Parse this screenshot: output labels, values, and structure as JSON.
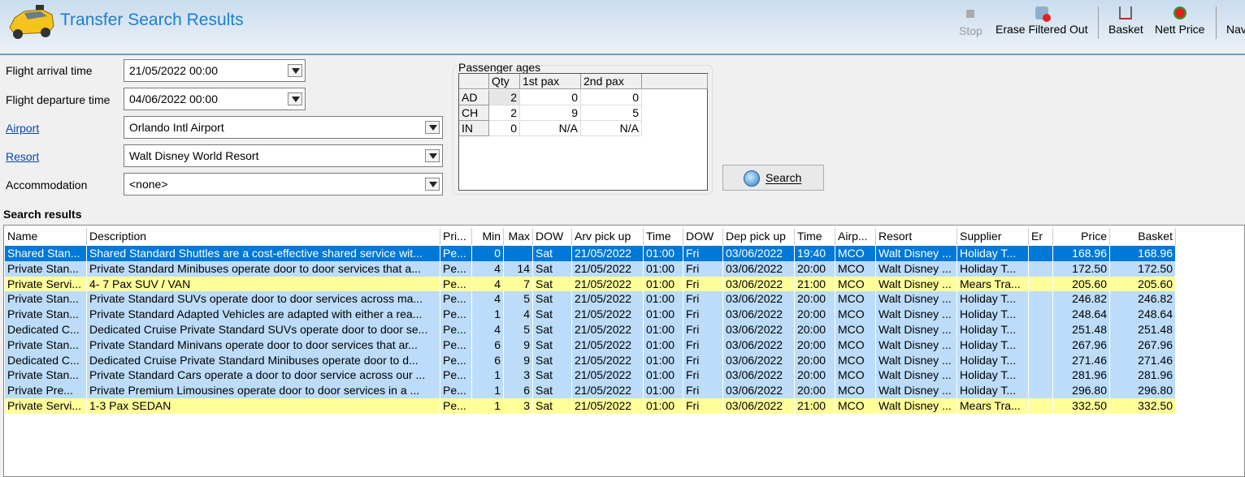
{
  "header": {
    "title": "Transfer Search Results"
  },
  "toolbar": {
    "stop": "Stop",
    "erase": "Erase Filtered Out",
    "basket": "Basket",
    "nett": "Nett Price",
    "nav": "Nav"
  },
  "form": {
    "arrival_label": "Flight arrival time",
    "arrival_value": "21/05/2022 00:00",
    "departure_label": "Flight departure time",
    "departure_value": "04/06/2022 00:00",
    "airport_label": "Airport",
    "airport_value": "Orlando Intl Airport",
    "resort_label": "Resort",
    "resort_value": "Walt Disney World Resort",
    "accom_label": "Accommodation",
    "accom_value": "<none>"
  },
  "pax": {
    "title": "Passenger ages",
    "headers": [
      "",
      "Qty",
      "1st pax",
      "2nd pax",
      ""
    ],
    "rows": [
      [
        "AD",
        "2",
        "0",
        "0"
      ],
      [
        "CH",
        "2",
        "9",
        "5"
      ],
      [
        "IN",
        "0",
        "N/A",
        "N/A"
      ]
    ]
  },
  "search_button": "Search",
  "results": {
    "label": "Search results",
    "columns": [
      "Name",
      "Description",
      "Pri...",
      "Min",
      "Max",
      "DOW",
      "Arv pick up",
      "Time",
      "DOW",
      "Dep pick up",
      "Time",
      "Airp...",
      "Resort",
      "Supplier",
      "Er",
      "Price",
      "Basket"
    ],
    "rows": [
      {
        "style": "sel",
        "cells": [
          "Shared Stan...",
          "Shared Standard Shuttles are a cost-effective shared service wit...",
          "Pe...",
          "0",
          "",
          "Sat",
          "21/05/2022",
          "01:00",
          "Fri",
          "03/06/2022",
          "19:40",
          "MCO",
          "Walt Disney ...",
          "Holiday T...",
          "",
          "168.96",
          "168.96"
        ]
      },
      {
        "style": "blue",
        "cells": [
          "Private Stan...",
          "Private Standard Minibuses operate door to door services that a...",
          "Pe...",
          "4",
          "14",
          "Sat",
          "21/05/2022",
          "01:00",
          "Fri",
          "03/06/2022",
          "20:00",
          "MCO",
          "Walt Disney ...",
          "Holiday T...",
          "",
          "172.50",
          "172.50"
        ]
      },
      {
        "style": "yel",
        "cells": [
          "Private Servi...",
          "4- 7 Pax SUV / VAN",
          "Pe...",
          "4",
          "7",
          "Sat",
          "21/05/2022",
          "01:00",
          "Fri",
          "03/06/2022",
          "21:00",
          "MCO",
          "Walt Disney ...",
          "Mears Tra...",
          "",
          "205.60",
          "205.60"
        ]
      },
      {
        "style": "blue",
        "cells": [
          "Private Stan...",
          "Private Standard SUVs operate door to door services across ma...",
          "Pe...",
          "4",
          "5",
          "Sat",
          "21/05/2022",
          "01:00",
          "Fri",
          "03/06/2022",
          "20:00",
          "MCO",
          "Walt Disney ...",
          "Holiday T...",
          "",
          "246.82",
          "246.82"
        ]
      },
      {
        "style": "blue",
        "cells": [
          "Private Stan...",
          "Private Standard Adapted Vehicles are adapted with either a rea...",
          "Pe...",
          "1",
          "4",
          "Sat",
          "21/05/2022",
          "01:00",
          "Fri",
          "03/06/2022",
          "20:00",
          "MCO",
          "Walt Disney ...",
          "Holiday T...",
          "",
          "248.64",
          "248.64"
        ]
      },
      {
        "style": "blue",
        "cells": [
          "Dedicated C...",
          "Dedicated Cruise Private Standard SUVs operate door to door se...",
          "Pe...",
          "4",
          "5",
          "Sat",
          "21/05/2022",
          "01:00",
          "Fri",
          "03/06/2022",
          "20:00",
          "MCO",
          "Walt Disney ...",
          "Holiday T...",
          "",
          "251.48",
          "251.48"
        ]
      },
      {
        "style": "blue",
        "cells": [
          "Private Stan...",
          "Private Standard Minivans operate door to door services that ar...",
          "Pe...",
          "6",
          "9",
          "Sat",
          "21/05/2022",
          "01:00",
          "Fri",
          "03/06/2022",
          "20:00",
          "MCO",
          "Walt Disney ...",
          "Holiday T...",
          "",
          "267.96",
          "267.96"
        ]
      },
      {
        "style": "blue",
        "cells": [
          "Dedicated C...",
          "Dedicated Cruise Private Standard Minibuses operate door to d...",
          "Pe...",
          "6",
          "9",
          "Sat",
          "21/05/2022",
          "01:00",
          "Fri",
          "03/06/2022",
          "20:00",
          "MCO",
          "Walt Disney ...",
          "Holiday T...",
          "",
          "271.46",
          "271.46"
        ]
      },
      {
        "style": "blue",
        "cells": [
          "Private Stan...",
          "Private Standard Cars operate a door to door service across our ...",
          "Pe...",
          "1",
          "3",
          "Sat",
          "21/05/2022",
          "01:00",
          "Fri",
          "03/06/2022",
          "20:00",
          "MCO",
          "Walt Disney ...",
          "Holiday T...",
          "",
          "281.96",
          "281.96"
        ]
      },
      {
        "style": "blue",
        "cells": [
          "Private Pre...",
          "Private Premium Limousines operate door to door services in a ...",
          "Pe...",
          "1",
          "6",
          "Sat",
          "21/05/2022",
          "01:00",
          "Fri",
          "03/06/2022",
          "20:00",
          "MCO",
          "Walt Disney ...",
          "Holiday T...",
          "",
          "296.80",
          "296.80"
        ]
      },
      {
        "style": "yel",
        "cells": [
          "Private Servi...",
          "1-3 Pax SEDAN",
          "Pe...",
          "1",
          "3",
          "Sat",
          "21/05/2022",
          "01:00",
          "Fri",
          "03/06/2022",
          "21:00",
          "MCO",
          "Walt Disney ...",
          "Mears Tra...",
          "",
          "332.50",
          "332.50"
        ]
      }
    ]
  }
}
